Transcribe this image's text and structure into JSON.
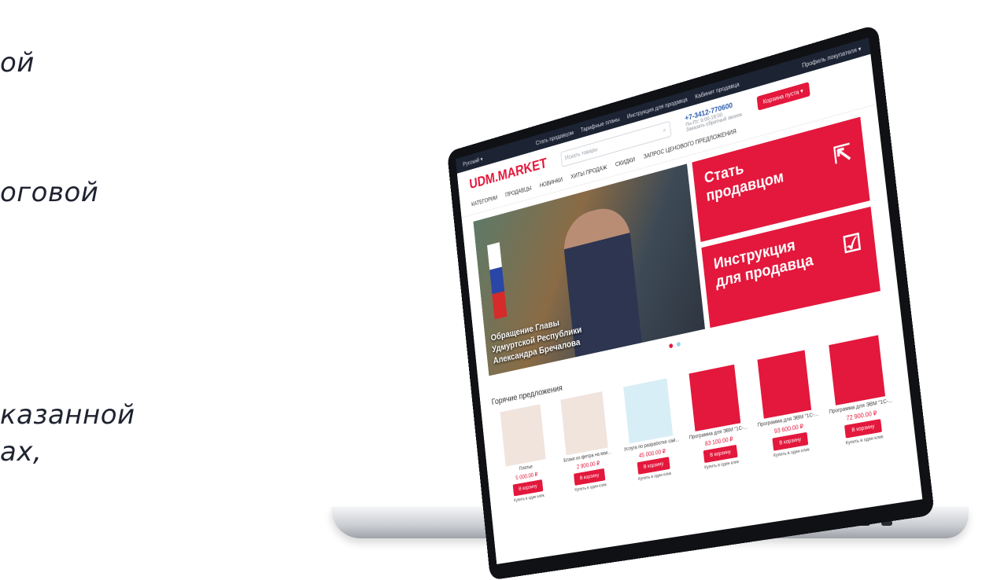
{
  "left_text": {
    "line1": "ой",
    "line2": "оговой",
    "line3": "казанной",
    "line4": "ах,"
  },
  "site": {
    "topbar": {
      "language": "Русский ▾",
      "link1": "Стать продавцом",
      "link2": "Тарифные планы",
      "link3": "Инструкция для продавца",
      "link4": "Кабинет продавца",
      "profile": "Профиль покупателя ▾"
    },
    "logo": "UDM.MARKET",
    "search_placeholder": "Искать товары",
    "phone": "+7-3412-770600",
    "phone_hours": "Пн-Пт: 9:00-18:00",
    "callback": "Заказать обратный звонок",
    "cart": "Корзина пуста ▾",
    "nav": [
      "КАТЕГОРИИ",
      "ПРОДАВЦЫ",
      "НОВИНКИ",
      "ХИТЫ ПРОДАЖ",
      "СКИДКИ",
      "ЗАПРОС ЦЕНОВОГО ПРЕДЛОЖЕНИЯ"
    ],
    "banner_caption": [
      "Обращение Главы",
      "Удмуртской Республики",
      "Александра Бречалова"
    ],
    "banner_seller": [
      "Стать",
      "продавцом"
    ],
    "banner_instr": [
      "Инструкция",
      "для продавца"
    ],
    "hot_title": "Горячие предложения",
    "products": [
      {
        "name": "Платье",
        "price": "5 000.00 ₽",
        "btn": "В корзину",
        "one": "Купить в один клик"
      },
      {
        "name": "Блэки из фетра на мак...",
        "price": "2 900.00 ₽",
        "btn": "В корзину",
        "one": "Купить в один клик"
      },
      {
        "name": "Услуга по разработке сай...",
        "price": "45 000.00 ₽",
        "btn": "В корзину",
        "one": "Купить в один клик"
      },
      {
        "name": "Программа для ЭВМ \"1С-...",
        "price": "83 100.00 ₽",
        "btn": "В корзину",
        "one": "Купить в один клик"
      },
      {
        "name": "Программа для ЭВМ \"1С-...",
        "price": "93 600.00 ₽",
        "btn": "В корзину",
        "one": "Купить в один клик"
      },
      {
        "name": "Программа для ЭВМ \"1С-...",
        "price": "72 900.00 ₽",
        "btn": "В корзину",
        "one": "Купить в один клик"
      }
    ]
  }
}
